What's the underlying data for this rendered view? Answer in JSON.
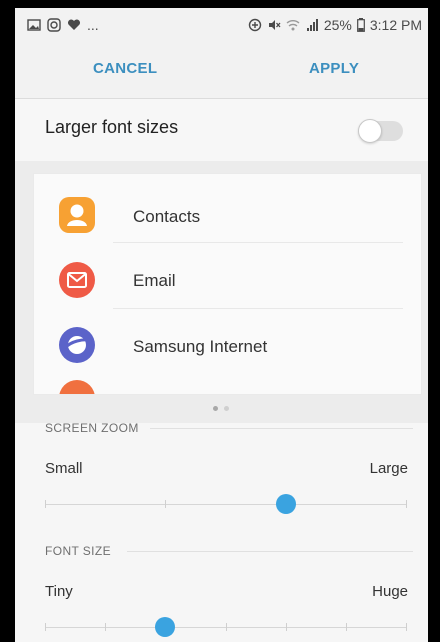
{
  "status_bar": {
    "left_icons": [
      "image-icon",
      "instagram-icon",
      "heart-icon"
    ],
    "left_more": "...",
    "battery_percent": "25%",
    "time": "3:12 PM"
  },
  "action_bar": {
    "cancel_label": "CANCEL",
    "apply_label": "APPLY"
  },
  "larger_font": {
    "label": "Larger font sizes",
    "enabled": false
  },
  "preview": {
    "apps": [
      {
        "label": "Contacts",
        "icon": "contacts-icon",
        "color": "#f7a133"
      },
      {
        "label": "Email",
        "icon": "email-icon",
        "color": "#ef5a46"
      },
      {
        "label": "Samsung Internet",
        "icon": "samsung-internet-icon",
        "color": "#5b63c9"
      }
    ],
    "page_count": 2,
    "current_page": 1
  },
  "screen_zoom": {
    "header": "SCREEN ZOOM",
    "min_label": "Small",
    "max_label": "Large",
    "steps": 4,
    "value_step": 2
  },
  "font_size": {
    "header": "FONT SIZE",
    "min_label": "Tiny",
    "max_label": "Huge",
    "steps": 7,
    "value_step": 2
  },
  "colors": {
    "accent": "#3aa3e0",
    "action_text": "#3c8fbf"
  }
}
